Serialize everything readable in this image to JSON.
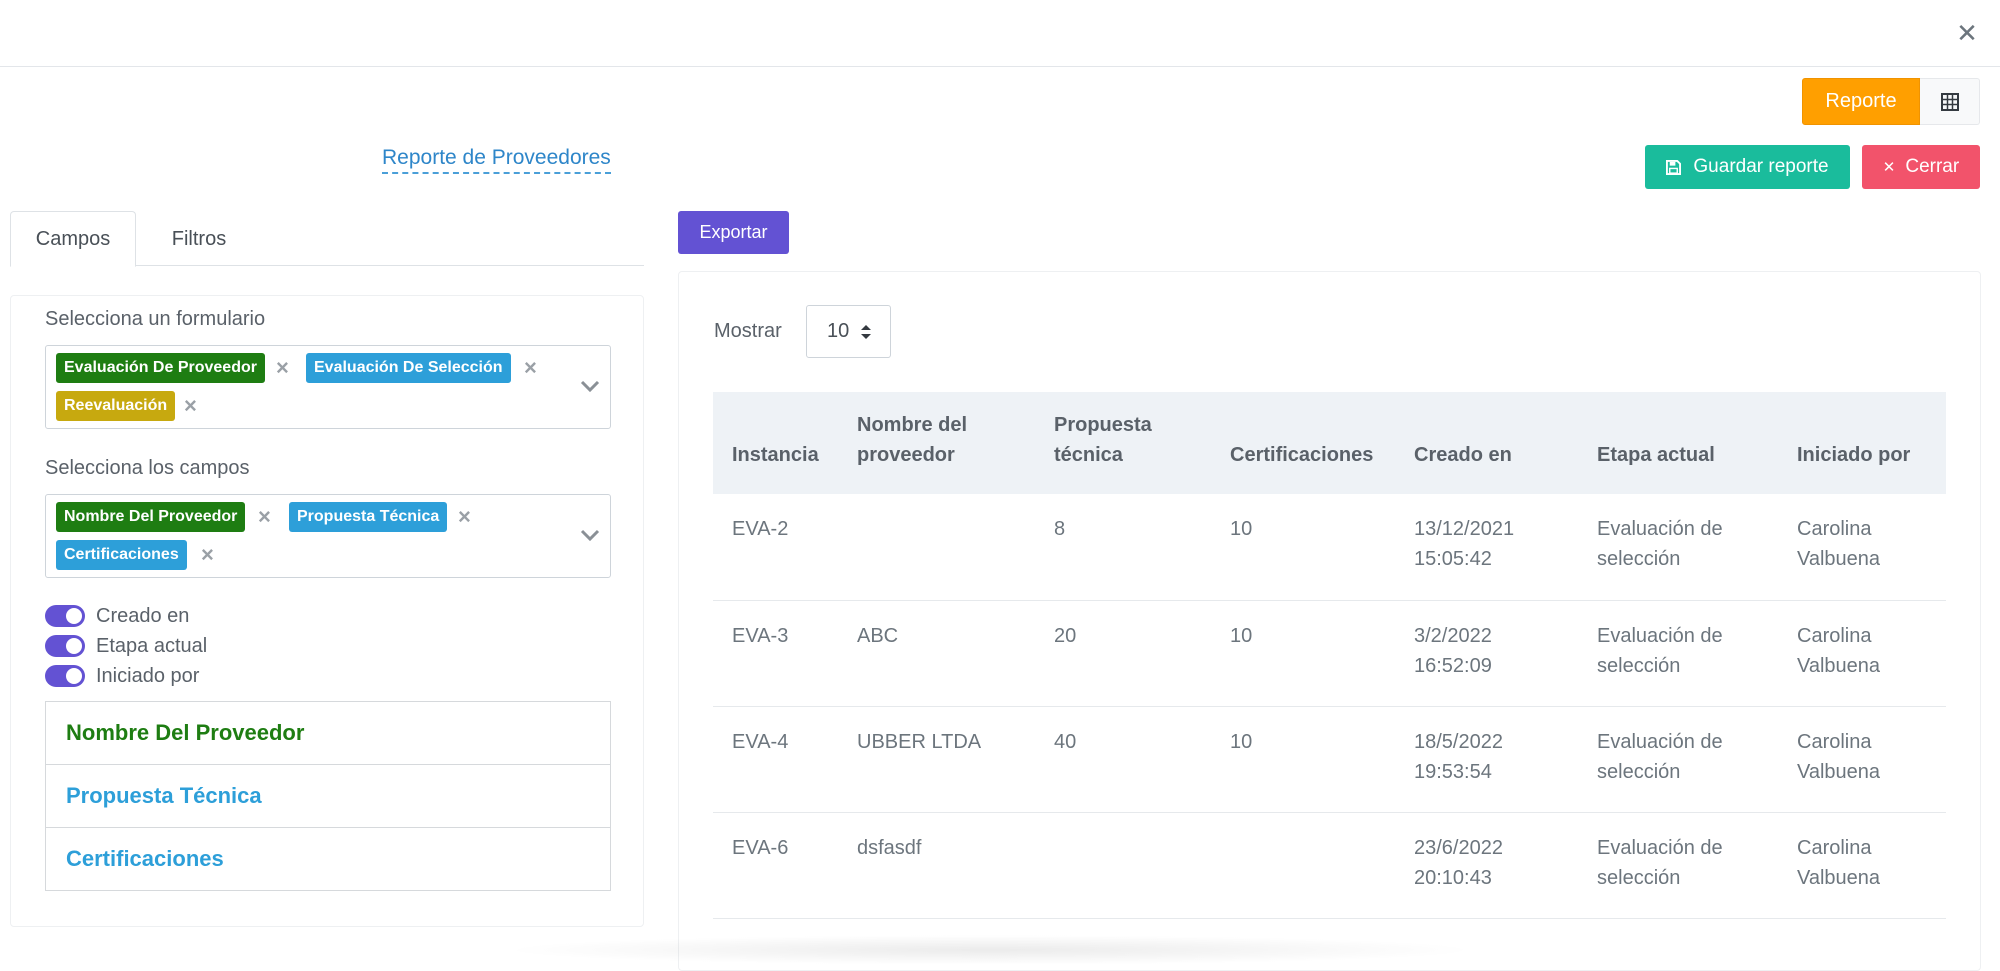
{
  "header": {
    "close_icon": "close-icon"
  },
  "view_toggle": {
    "report_label": "Reporte",
    "grid_icon": "grid-icon",
    "active_color": "#ff9f00"
  },
  "report": {
    "title": "Reporte de Proveedores"
  },
  "actions": {
    "save_label": "Guardar reporte",
    "save_icon": "floppy-disk-icon",
    "save_color": "#1abc9c",
    "close_label": "Cerrar",
    "close_icon": "close-icon",
    "close_color": "#f2536b"
  },
  "tabs": {
    "fields": "Campos",
    "filters": "Filtros"
  },
  "form_select": {
    "label": "Selecciona un formulario",
    "chips": [
      {
        "label": "Evaluación De Proveedor",
        "color": "#1e7d12"
      },
      {
        "label": "Evaluación De Selección",
        "color": "#2d9fd9"
      },
      {
        "label": "Reevaluación",
        "color": "#c7a90f"
      }
    ]
  },
  "fields_select": {
    "label": "Selecciona los campos",
    "chips": [
      {
        "label": "Nombre Del Proveedor",
        "color": "#1e7d12"
      },
      {
        "label": "Propuesta Técnica",
        "color": "#2d9fd9"
      },
      {
        "label": "Certificaciones",
        "color": "#2d9fd9"
      }
    ]
  },
  "toggles": [
    {
      "label": "Creado en",
      "on": true
    },
    {
      "label": "Etapa actual",
      "on": true
    },
    {
      "label": "Iniciado por",
      "on": true
    }
  ],
  "field_list": [
    {
      "label": "Nombre Del Proveedor"
    },
    {
      "label": "Propuesta Técnica"
    },
    {
      "label": "Certificaciones"
    }
  ],
  "export": {
    "label": "Exportar",
    "color": "#6352d3"
  },
  "table": {
    "show_label": "Mostrar",
    "page_size": "10",
    "headers": {
      "instance": "Instancia",
      "supplier_name": "Nombre del proveedor",
      "technical_proposal": "Propuesta técnica",
      "certifications": "Certificaciones",
      "created_at": "Creado en",
      "current_stage": "Etapa actual",
      "started_by": "Iniciado por"
    },
    "rows": [
      {
        "instance": "EVA-2",
        "supplier_name": "",
        "technical_proposal": "8",
        "certifications": "10",
        "created_date": "13/12/2021",
        "created_time": "15:05:42",
        "stage_1": "Evaluación de",
        "stage_2": "selección",
        "by_1": "Carolina",
        "by_2": "Valbuena"
      },
      {
        "instance": "EVA-3",
        "supplier_name": "ABC",
        "technical_proposal": "20",
        "certifications": "10",
        "created_date": "3/2/2022",
        "created_time": "16:52:09",
        "stage_1": "Evaluación de",
        "stage_2": "selección",
        "by_1": "Carolina",
        "by_2": "Valbuena"
      },
      {
        "instance": "EVA-4",
        "supplier_name": "UBBER LTDA",
        "technical_proposal": "40",
        "certifications": "10",
        "created_date": "18/5/2022",
        "created_time": "19:53:54",
        "stage_1": "Evaluación de",
        "stage_2": "selección",
        "by_1": "Carolina",
        "by_2": "Valbuena"
      },
      {
        "instance": "EVA-6",
        "supplier_name": "dsfasdf",
        "technical_proposal": "",
        "certifications": "",
        "created_date": "23/6/2022",
        "created_time": "20:10:43",
        "stage_1": "Evaluación de",
        "stage_2": "selección",
        "by_1": "Carolina",
        "by_2": "Valbuena"
      }
    ]
  }
}
